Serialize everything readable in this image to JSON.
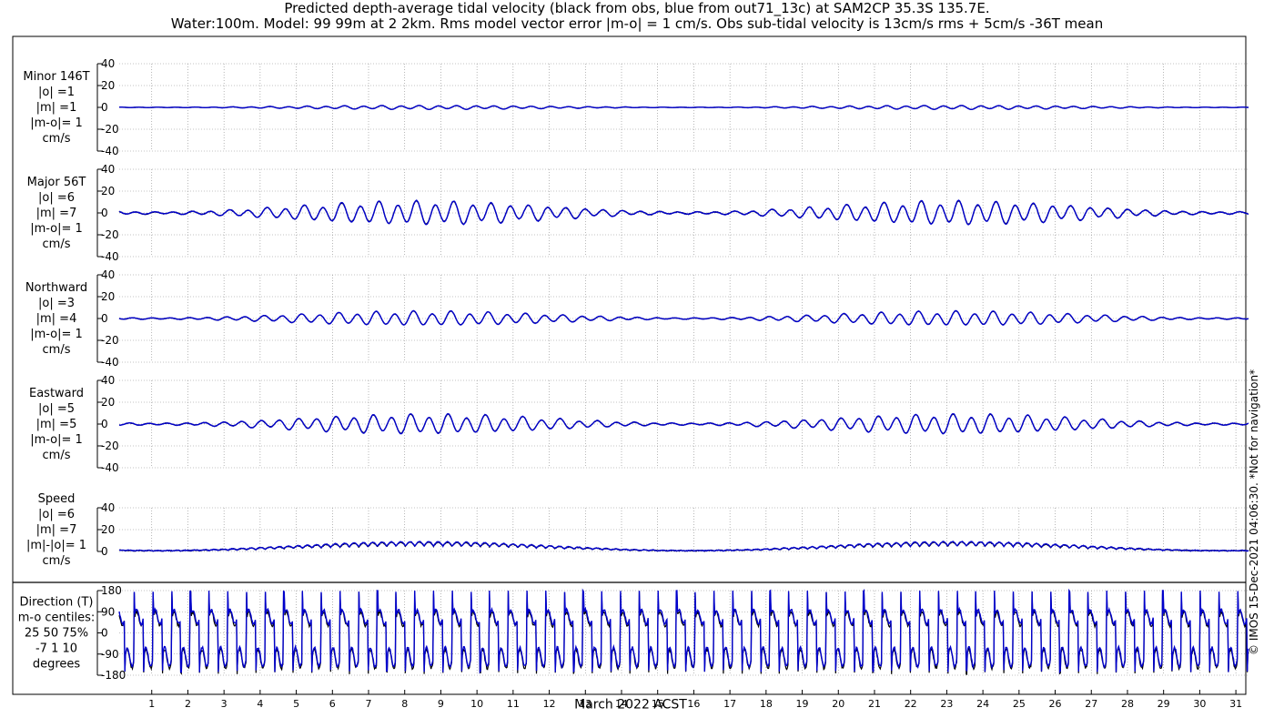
{
  "header": {
    "title_line1": "Predicted depth-average tidal velocity (black from obs, blue from out71_13c) at SAM2CP 35.3S 135.7E.",
    "title_line2": "Water:100m. Model: 99 99m at 2 2km. Rms model vector error |m-o| = 1 cm/s. Obs sub-tidal velocity is 13cm/s rms + 5cm/s -36T mean"
  },
  "footer": {
    "copyright": "© IMOS 15-Dec-2021 04:06:30. *Not for navigation*"
  },
  "colors": {
    "obs": "#000000",
    "model": "#0000cc",
    "grid": "#888888"
  },
  "chart_data": {
    "type": "line",
    "xlabel": "March 2022 ACST",
    "x_ticks": [
      "1",
      "2",
      "3",
      "4",
      "5",
      "6",
      "7",
      "8",
      "9",
      "10",
      "11",
      "12",
      "13",
      "14",
      "15",
      "16",
      "17",
      "18",
      "19",
      "20",
      "21",
      "22",
      "23",
      "24",
      "25",
      "26",
      "27",
      "28",
      "29",
      "30",
      "31"
    ],
    "xlim": [
      0.1,
      31.35
    ],
    "series": [
      {
        "name": "obs"
      },
      {
        "name": "model"
      }
    ],
    "panels": [
      {
        "label": [
          "Minor 146T",
          "|o| =1",
          "|m| =1",
          "|m-o|= 1",
          "cm/s"
        ],
        "ylim": [
          -40,
          40
        ],
        "yticks": [
          "40",
          "20",
          "0",
          "-20",
          "-40"
        ],
        "amplitude": 1.5,
        "kind": "tidal"
      },
      {
        "label": [
          "Major 56T",
          "|o| =6",
          "|m| =7",
          "|m-o|= 1",
          "cm/s"
        ],
        "ylim": [
          -40,
          40
        ],
        "yticks": [
          "40",
          "20",
          "0",
          "-20",
          "-40"
        ],
        "amplitude": 9,
        "kind": "tidal"
      },
      {
        "label": [
          "Northward",
          "|o| =3",
          "|m| =4",
          "|m-o|= 1",
          "cm/s"
        ],
        "ylim": [
          -40,
          40
        ],
        "yticks": [
          "40",
          "20",
          "0",
          "-20",
          "-40"
        ],
        "amplitude": 5.5,
        "kind": "tidal"
      },
      {
        "label": [
          "Eastward",
          "|o| =5",
          "|m| =5",
          "|m-o|= 1",
          "cm/s"
        ],
        "ylim": [
          -40,
          40
        ],
        "yticks": [
          "40",
          "20",
          "0",
          "-20",
          "-40"
        ],
        "amplitude": 7.5,
        "kind": "tidal"
      },
      {
        "label": [
          "Speed",
          "|o| =6",
          "|m| =7",
          "|m|-|o|= 1",
          "cm/s"
        ],
        "ylim": [
          0,
          40
        ],
        "yticks": [
          "40",
          "20",
          "0"
        ],
        "amplitude": 9,
        "kind": "speed"
      },
      {
        "label": [
          "Direction (T)",
          "m-o centiles:",
          "25  50  75%",
          "-7   1  10",
          "degrees"
        ],
        "ylim": [
          -180,
          180
        ],
        "yticks": [
          "180",
          "90",
          "0",
          "-90",
          "-180"
        ],
        "amplitude": 180,
        "kind": "direction"
      }
    ]
  }
}
